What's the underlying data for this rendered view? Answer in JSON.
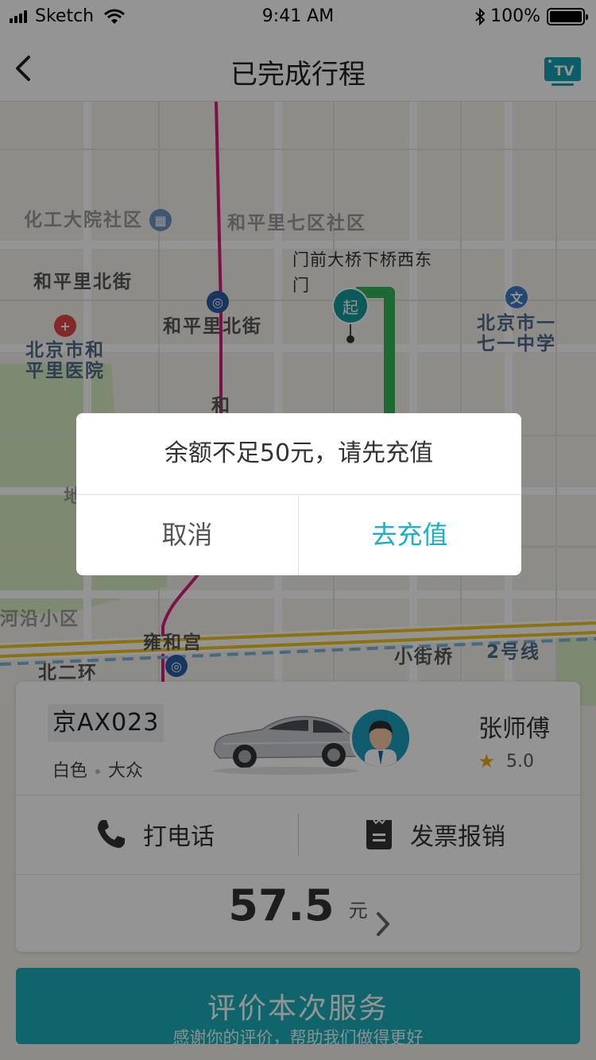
{
  "status_bar": {
    "carrier": "Sketch",
    "time": "9:41 AM",
    "battery": "100%",
    "battery_level": 1.0
  },
  "nav": {
    "title": "已完成行程",
    "back_icon": "chevron-left-icon",
    "tv_icon": "tv-icon",
    "tv_label": "TV"
  },
  "map": {
    "labels": [
      "化工大院社区",
      "和平里七区社区",
      "和平里北街",
      "和平里北街",
      "北京市和",
      "平里医院",
      "北京市一",
      "七一中学",
      "和",
      "地",
      "河沿小区",
      "雍和宫",
      "北二环",
      "小街桥",
      "2号线"
    ],
    "start_pin_label": "起",
    "start_address": "门前大桥下桥西东门",
    "start_address_lines": [
      "门前大桥下桥西东",
      "门"
    ],
    "colors": {
      "route": "#34b558",
      "metro": "#d81e7a",
      "ring_road": "#f0c419",
      "start_pin": "#139c9c"
    }
  },
  "trip": {
    "plate": "京AX023",
    "car_color": "白色",
    "car_brand": "大众",
    "driver_name": "张师傅",
    "rating": "5.0",
    "actions": {
      "call_label": "打电话",
      "invoice_label": "发票报销"
    },
    "price": "57.5",
    "price_unit": "元"
  },
  "rate_button": {
    "label": "评价本次服务",
    "sublabel": "感谢你的评价，帮助我们做得更好"
  },
  "dialog": {
    "message": "余额不足50元，请先充值",
    "cancel_label": "取消",
    "confirm_label": "去充值"
  }
}
